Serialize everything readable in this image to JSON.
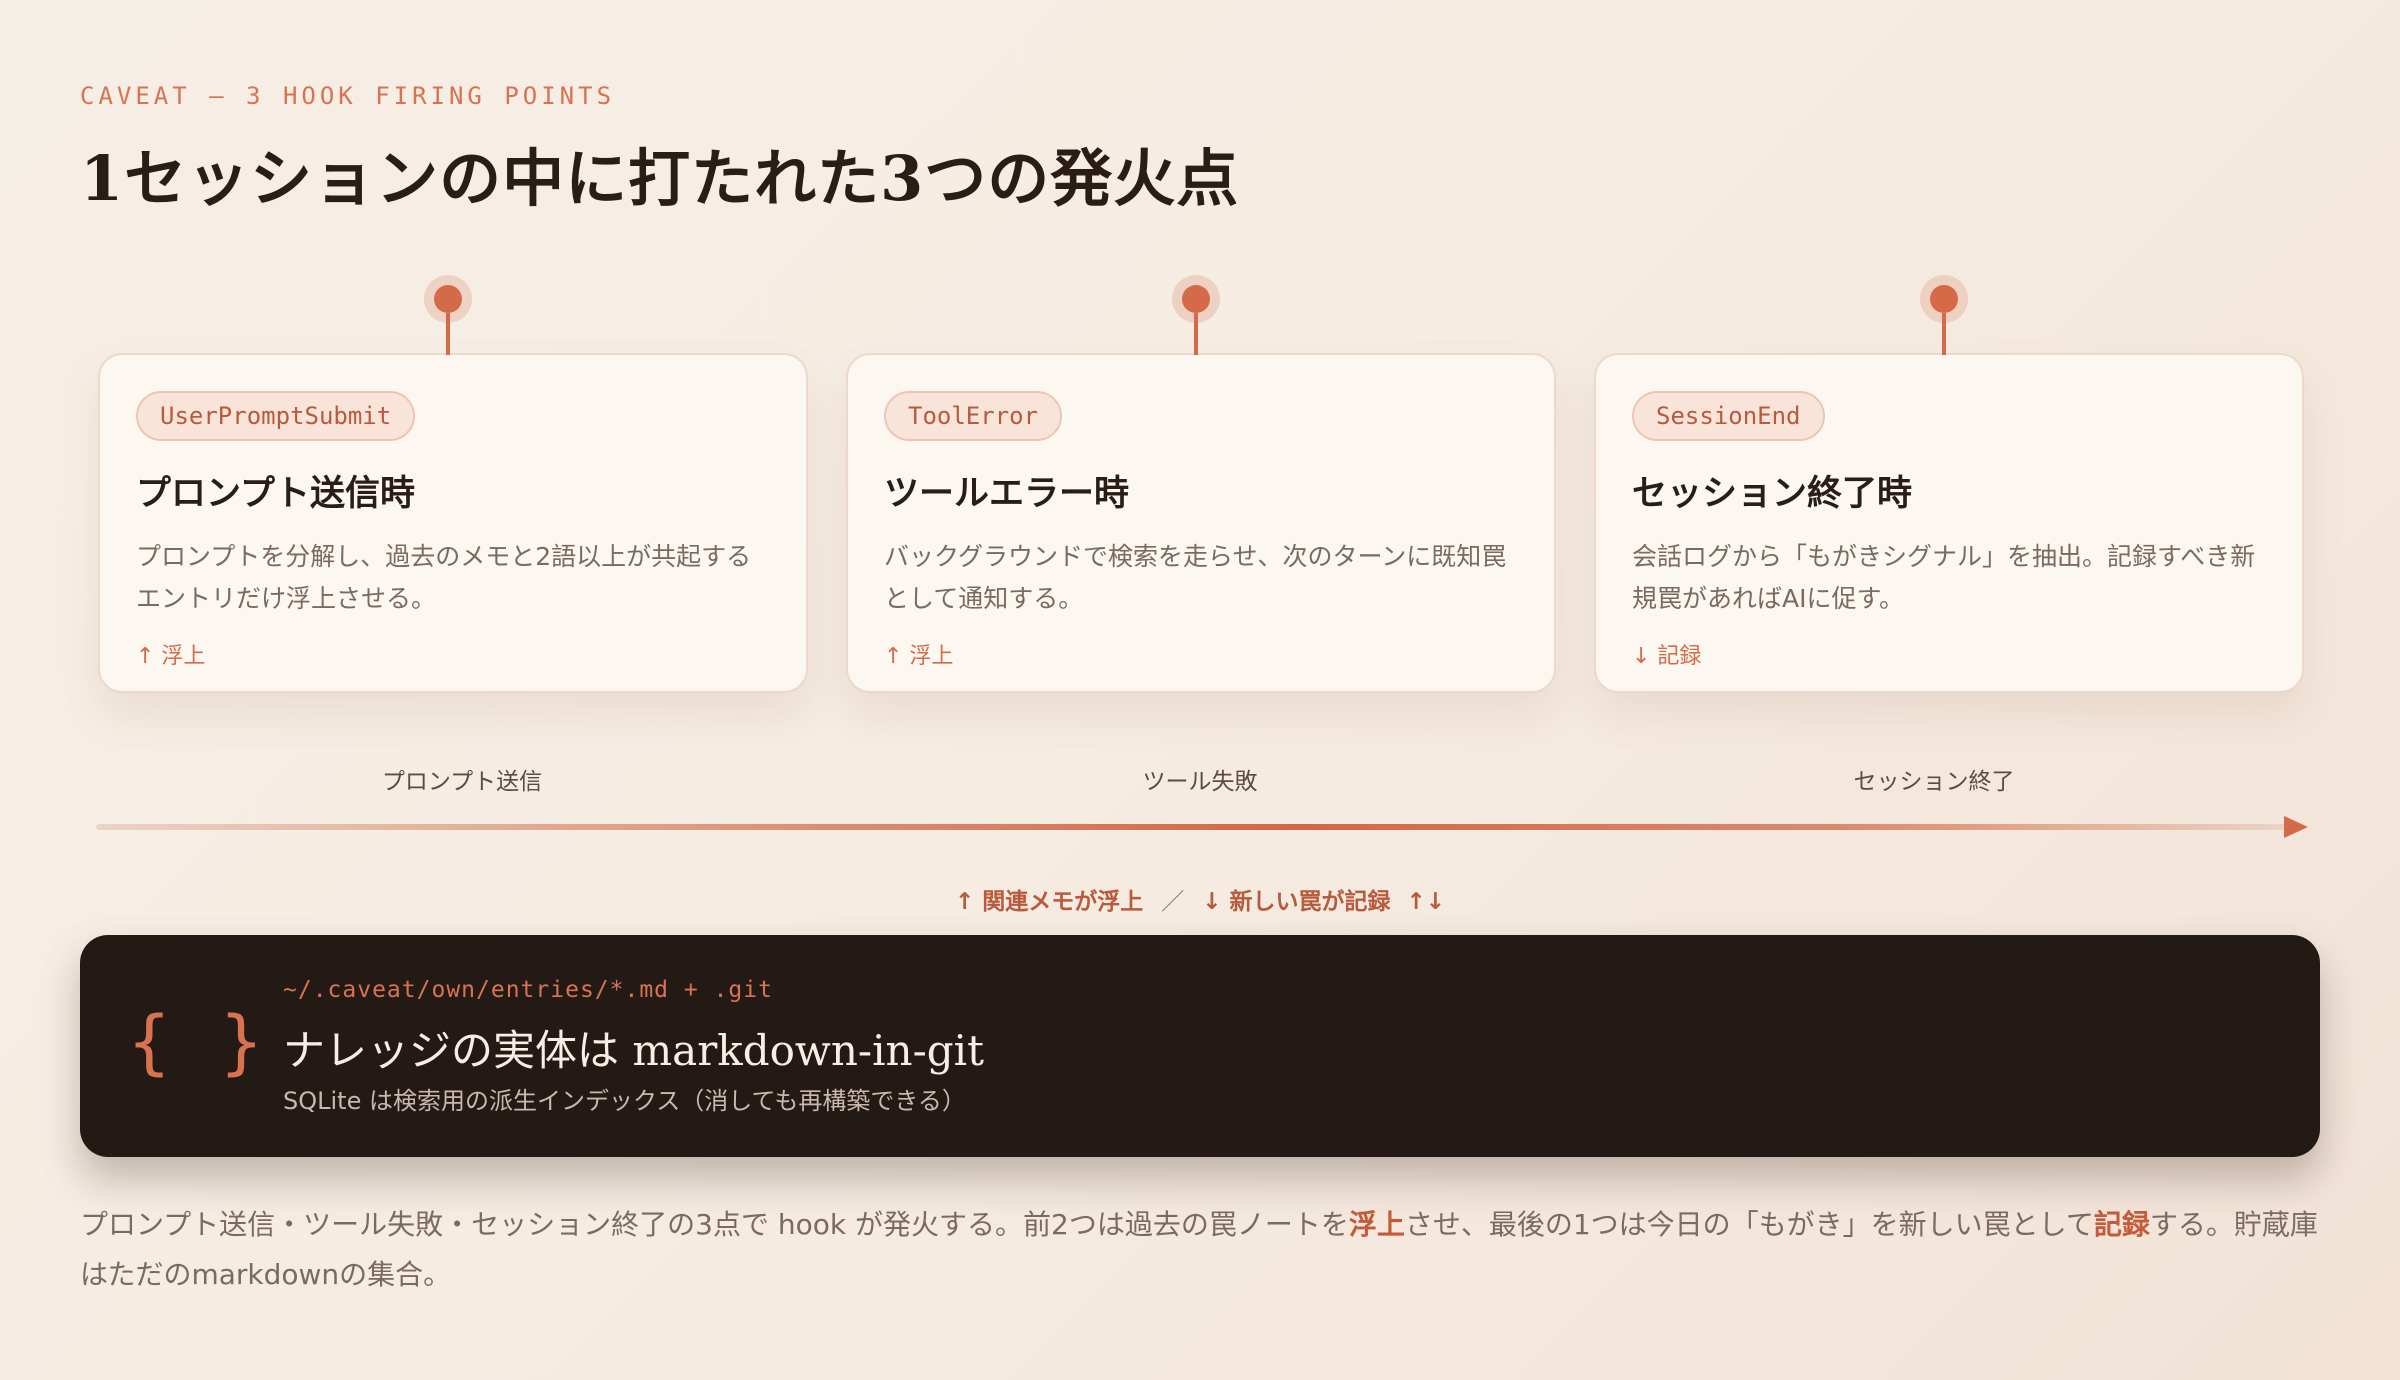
{
  "eyebrow": "CAVEAT — 3 HOOK FIRING POINTS",
  "title": "1セッションの中に打たれた3つの発火点",
  "cards": [
    {
      "tag": "UserPromptSubmit",
      "title": "プロンプト送信時",
      "desc": "プロンプトを分解し、過去のメモと2語以上が共起するエントリだけ浮上させる。",
      "direction": "↑ 浮上"
    },
    {
      "tag": "ToolError",
      "title": "ツールエラー時",
      "desc": "バックグラウンドで検索を走らせ、次のターンに既知罠として通知する。",
      "direction": "↑ 浮上"
    },
    {
      "tag": "SessionEnd",
      "title": "セッション終了時",
      "desc": "会話ログから「もがきシグナル」を抽出。記録すべき新規罠があればAIに促す。",
      "direction": "↓ 記録"
    }
  ],
  "timeline": {
    "labels": [
      "プロンプト送信",
      "ツール失敗",
      "セッション終了"
    ]
  },
  "legend": {
    "up": "↑ 関連メモが浮上",
    "separator": "／",
    "down": "↓ 新しい罠が記録",
    "both": "↑↓"
  },
  "storage": {
    "icon": "braces-icon",
    "braces": "{ }",
    "path": "~/.caveat/own/entries/*.md + .git",
    "title": "ナレッジの実体は markdown-in-git",
    "subtitle": "SQLite は検索用の派生インデックス（消しても再構築できる）"
  },
  "footer": {
    "part1": "プロンプト送信・ツール失敗・セッション終了の3点で hook が発火する。前2つは過去の罠ノートを",
    "emph1": "浮上",
    "part2": "させ、最後の1つは今日の「もがき」を新しい罠として",
    "emph2": "記録",
    "part3": "する。貯蔵庫はただのmarkdownの集合。"
  },
  "colors": {
    "accent": "#d46a48",
    "dark_panel": "#241a15",
    "background": "#f6efe6"
  }
}
